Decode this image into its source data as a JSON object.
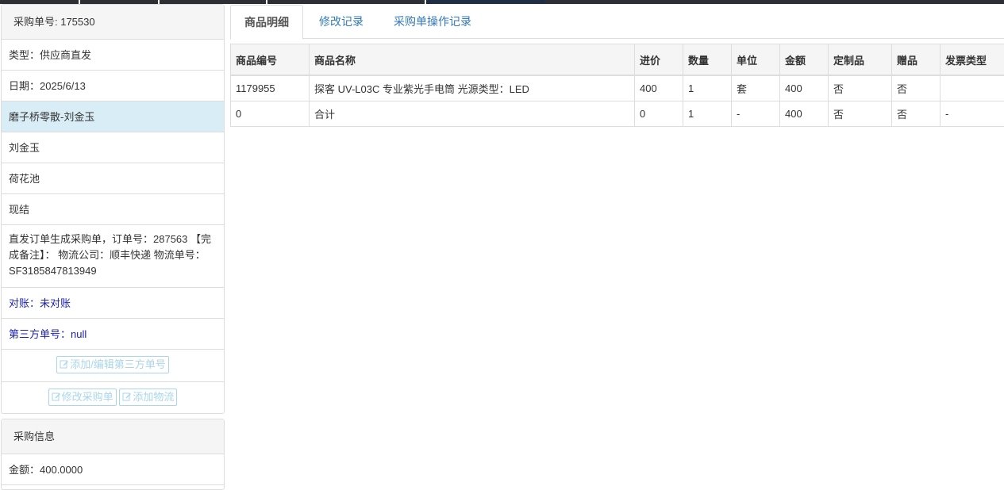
{
  "left": {
    "heading": "采购单号: 175530",
    "rows": {
      "type": "类型：供应商直发",
      "date": "日期：2025/6/13",
      "store": "磨子桥零散-刘金玉",
      "person": "刘金玉",
      "location": "荷花池",
      "payment": "现结",
      "remark": "直发订单生成采购单，订单号：287563 【完成备注】： 物流公司：顺丰快递 物流单号：SF3185847813949",
      "reconcile": "对账：未对账",
      "third_party_no": "第三方单号：null"
    },
    "buttons": {
      "edit_third_party": "添加/编辑第三方单号",
      "edit_order": "修改采购单",
      "add_logistics": "添加物流"
    }
  },
  "left2": {
    "heading": "采购信息",
    "amount": "金额：400.0000"
  },
  "tabs": [
    "商品明细",
    "修改记录",
    "采购单操作记录"
  ],
  "table": {
    "headers": [
      "商品编号",
      "商品名称",
      "进价",
      "数量",
      "单位",
      "金额",
      "定制品",
      "赠品",
      "发票类型"
    ],
    "rows": [
      [
        "1179955",
        "探客 UV-L03C 专业紫光手电筒 光源类型：LED",
        "400",
        "1",
        "套",
        "400",
        "否",
        "否",
        ""
      ],
      [
        "0",
        "合计",
        "0",
        "1",
        "-",
        "400",
        "否",
        "否",
        "-"
      ]
    ]
  },
  "colors": {
    "accent": "#337ab7",
    "highlight_row": "#d9edf7",
    "blue_text": "#1a1fb5",
    "button_outline": "#a9d6ea"
  },
  "icons": {
    "edit": "edit-icon"
  }
}
